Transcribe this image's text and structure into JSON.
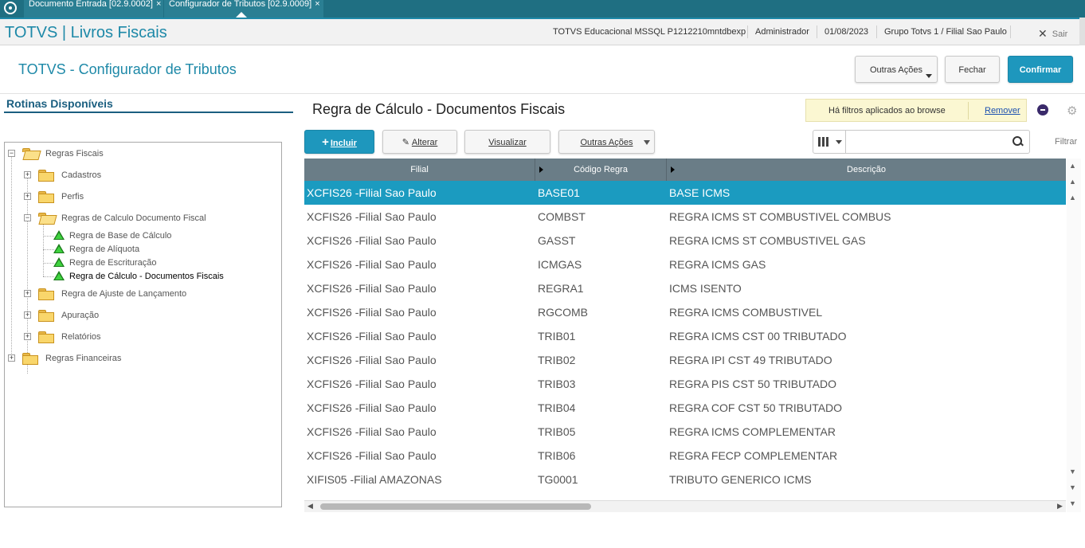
{
  "tabs": [
    {
      "label": "Documento Entrada [02.9.0002]"
    },
    {
      "label": "Configurador de Tributos [02.9.0009]"
    }
  ],
  "header": {
    "app_title": "TOTVS | Livros Fiscais",
    "environment": "TOTVS Educacional MSSQL P1212210mntdbexp",
    "user": "Administrador",
    "date": "01/08/2023",
    "company": "Grupo Totvs 1 / Filial Sao Paulo",
    "exit_label": "Sair"
  },
  "page": {
    "title": "TOTVS - Configurador de Tributos",
    "buttons": {
      "outras": "Outras Ações",
      "fechar": "Fechar",
      "confirmar": "Confirmar"
    }
  },
  "left": {
    "title": "Rotinas Disponíveis",
    "tree": [
      "Regras Fiscais",
      "Cadastros",
      "Perfis",
      "Regras de Calculo Documento Fiscal",
      "Regra de Base de Cálculo",
      "Regra de Alíquota",
      "Regra de Escrituração",
      "Regra de Cálculo - Documentos Fiscais",
      "Regra de Ajuste de Lançamento",
      "Apuração",
      "Relatórios",
      "Regras Financeiras"
    ]
  },
  "main": {
    "title": "Regra de Cálculo - Documentos Fiscais",
    "filter": {
      "text": "Há filtros aplicados ao browse",
      "remove": "Remover"
    },
    "toolbar": {
      "incluir": "Incluir",
      "alterar": "Alterar",
      "visualizar": "Visualizar",
      "outras": "Outras Ações"
    },
    "filtrar": "Filtrar",
    "columns": [
      "Filial",
      "Código Regra",
      "Descrição"
    ],
    "rows": [
      [
        "XCFIS26 -Filial Sao Paulo",
        "BASE01",
        "BASE ICMS"
      ],
      [
        "XCFIS26 -Filial Sao Paulo",
        "COMBST",
        "REGRA ICMS ST COMBUSTIVEL COMBUS"
      ],
      [
        "XCFIS26 -Filial Sao Paulo",
        "GASST",
        "REGRA ICMS ST COMBUSTIVEL GAS"
      ],
      [
        "XCFIS26 -Filial Sao Paulo",
        "ICMGAS",
        "REGRA ICMS GAS"
      ],
      [
        "XCFIS26 -Filial Sao Paulo",
        "REGRA1",
        "ICMS ISENTO"
      ],
      [
        "XCFIS26 -Filial Sao Paulo",
        "RGCOMB",
        "REGRA ICMS COMBUSTIVEL"
      ],
      [
        "XCFIS26 -Filial Sao Paulo",
        "TRIB01",
        "REGRA ICMS CST 00 TRIBUTADO"
      ],
      [
        "XCFIS26 -Filial Sao Paulo",
        "TRIB02",
        "REGRA IPI CST 49 TRIBUTADO"
      ],
      [
        "XCFIS26 -Filial Sao Paulo",
        "TRIB03",
        "REGRA PIS CST 50 TRIBUTADO"
      ],
      [
        "XCFIS26 -Filial Sao Paulo",
        "TRIB04",
        "REGRA COF CST 50 TRIBUTADO"
      ],
      [
        "XCFIS26 -Filial Sao Paulo",
        "TRIB05",
        "REGRA ICMS COMPLEMENTAR"
      ],
      [
        "XCFIS26 -Filial Sao Paulo",
        "TRIB06",
        "REGRA FECP COMPLEMENTAR"
      ],
      [
        "XIFIS05 -Filial AMAZONAS",
        "TG0001",
        "TRIBUTO GENERICO ICMS"
      ]
    ]
  },
  "colors": {
    "accent": "#1e89a8",
    "selected_row": "#1b9bc0",
    "primary_button": "#1e97bd",
    "grid_header": "#6a7d87",
    "filter_bg": "#fbf7d2"
  }
}
